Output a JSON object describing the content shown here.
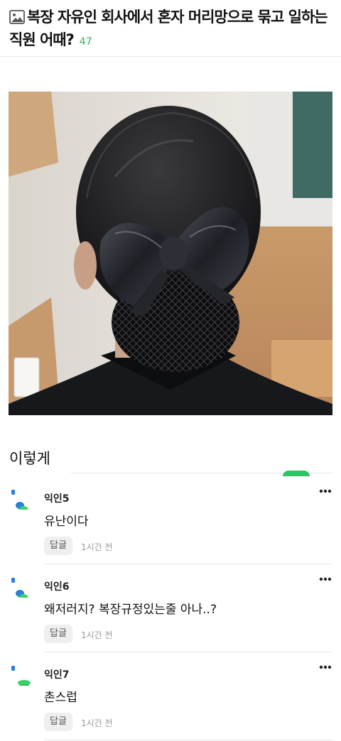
{
  "post": {
    "title_line1": "복장 자유인 회사에서 혼자 머리망으로 묶고 일하는",
    "title_line2": "직원 어때?",
    "comment_count": "47",
    "body": "이렇게"
  },
  "comments": [
    {
      "nick": "익인5",
      "text": "유난이다",
      "reply_label": "답글",
      "time": "1시간 전",
      "avatar_icon": "avatar-blue-green-icon"
    },
    {
      "nick": "익인6",
      "text": "왜저러지? 복장규정있는줄 아나..?",
      "reply_label": "답글",
      "time": "1시간 전",
      "avatar_icon": "avatar-blue-green-icon"
    },
    {
      "nick": "익인7",
      "text": "촌스럽",
      "reply_label": "답글",
      "time": "1시간 전",
      "avatar_icon": "avatar-green-icon"
    }
  ],
  "colors": {
    "accent_green": "#2fb45a",
    "avatar_blue": "#2a7fd6",
    "avatar_green": "#3ccf6a"
  }
}
